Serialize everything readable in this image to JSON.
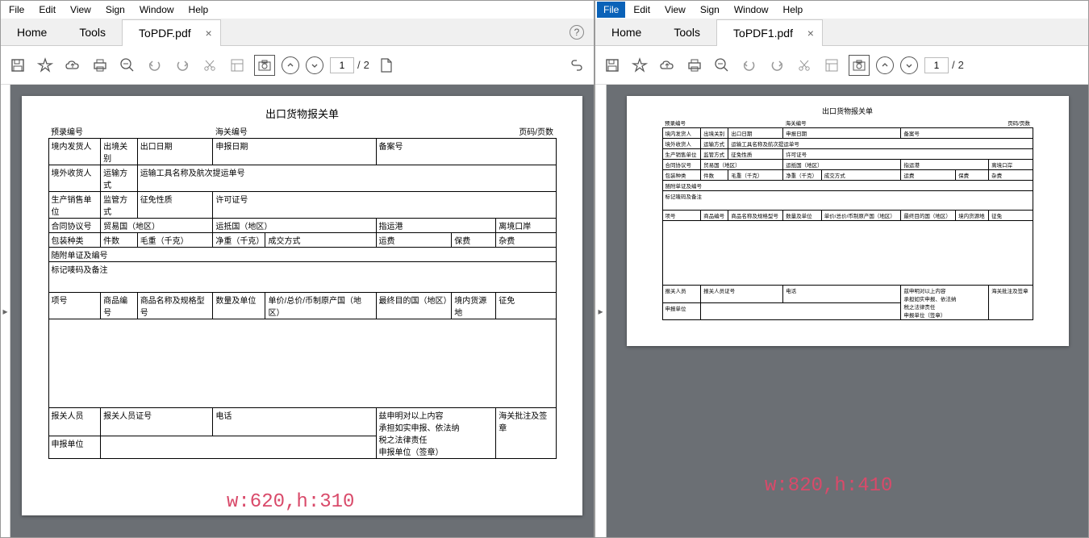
{
  "menus": [
    "File",
    "Edit",
    "View",
    "Sign",
    "Window",
    "Help"
  ],
  "menus_sel_right": 0,
  "tabs_common": {
    "home": "Home",
    "tools": "Tools"
  },
  "left": {
    "doc_tab": "ToPDF.pdf",
    "page_current": "1",
    "page_total": "2",
    "dim_label": "w:620,h:310"
  },
  "right": {
    "doc_tab": "ToPDF1.pdf",
    "page_current": "1",
    "page_total": "2",
    "dim_label": "w:820,h:410"
  },
  "form": {
    "title": "出口货物报关单",
    "header": {
      "c1": "预录编号",
      "c2": "海关编号",
      "c3": "页码/页数"
    },
    "r1": {
      "c1": "境内发货人",
      "c2": "出境关别",
      "c3": "出口日期",
      "c4": "申报日期",
      "c5": "备案号"
    },
    "r2": {
      "c1": "境外收货人",
      "c2": "运输方式",
      "c3": "运输工具名称及航次提运单号"
    },
    "r3": {
      "c1": "生产销售单位",
      "c2": "监管方式",
      "c3": "征免性质",
      "c4": "许可证号"
    },
    "r4": {
      "c1": "合同协议号",
      "c2": "贸易国（地区）",
      "c3": "运抵国（地区）",
      "c4": "指运港",
      "c5": "离境口岸"
    },
    "r5": {
      "c1": "包装种类",
      "c2": "件数",
      "c3": "毛重（千克）",
      "c4": "净重（千克）",
      "c5": "成交方式",
      "c6": "运费",
      "c7": "保费",
      "c8": "杂费"
    },
    "r6": "随附单证及编号",
    "r7": "标记唛码及备注",
    "r8": {
      "c1": "项号",
      "c2": "商品编号",
      "c3": "商品名称及规格型号",
      "c4": "数量及单位",
      "c5": "单价/总价/币制",
      "c5b": "原产国（地区）",
      "c6": "最终目的国（地区）",
      "c7": "境内货源地",
      "c8": "征免"
    },
    "r9": {
      "c1": "报关人员",
      "c2": "报关人员证号",
      "c3": "电话",
      "c4a": "兹申明对以上内容",
      "c4b": "承担如实申报、依法纳",
      "c4c": "税之法律责任",
      "c5": "海关批注及签章"
    },
    "r10": {
      "c1": "申报单位",
      "c2": "申报单位（签章）"
    }
  }
}
